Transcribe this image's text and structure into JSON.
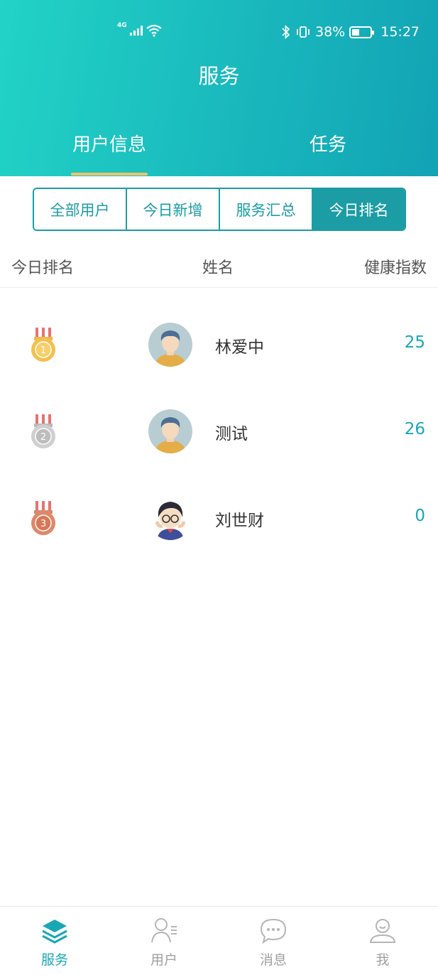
{
  "status_bar": {
    "network": "4G",
    "battery_percent": "38%",
    "time": "15:27"
  },
  "header": {
    "title": "服务"
  },
  "tabs": [
    {
      "label": "用户信息",
      "active": true
    },
    {
      "label": "任务",
      "active": false
    }
  ],
  "segments": [
    {
      "label": "全部用户",
      "active": false
    },
    {
      "label": "今日新增",
      "active": false
    },
    {
      "label": "服务汇总",
      "active": false
    },
    {
      "label": "今日排名",
      "active": true
    }
  ],
  "table": {
    "columns": [
      "今日排名",
      "姓名",
      "健康指数"
    ],
    "rows": [
      {
        "rank": "1",
        "medal": "gold-medal-icon",
        "avatar": "male-avatar-icon",
        "name": "林爱中",
        "score": "25"
      },
      {
        "rank": "2",
        "medal": "silver-medal-icon",
        "avatar": "male-avatar-icon",
        "name": "测试",
        "score": "26"
      },
      {
        "rank": "3",
        "medal": "bronze-medal-icon",
        "avatar": "cartoon-avatar-icon",
        "name": "刘世财",
        "score": "0"
      }
    ]
  },
  "bottom_nav": [
    {
      "label": "服务",
      "icon": "layers-icon",
      "active": true
    },
    {
      "label": "用户",
      "icon": "user-list-icon",
      "active": false
    },
    {
      "label": "消息",
      "icon": "chat-bubble-icon",
      "active": false
    },
    {
      "label": "我",
      "icon": "profile-icon",
      "active": false
    }
  ],
  "colors": {
    "header_gradient_start": "#22d3c6",
    "header_gradient_end": "#12a3b5",
    "accent": "#1c9ca5",
    "score": "#1aa7b4",
    "tab_underline": "#f0c36a"
  }
}
